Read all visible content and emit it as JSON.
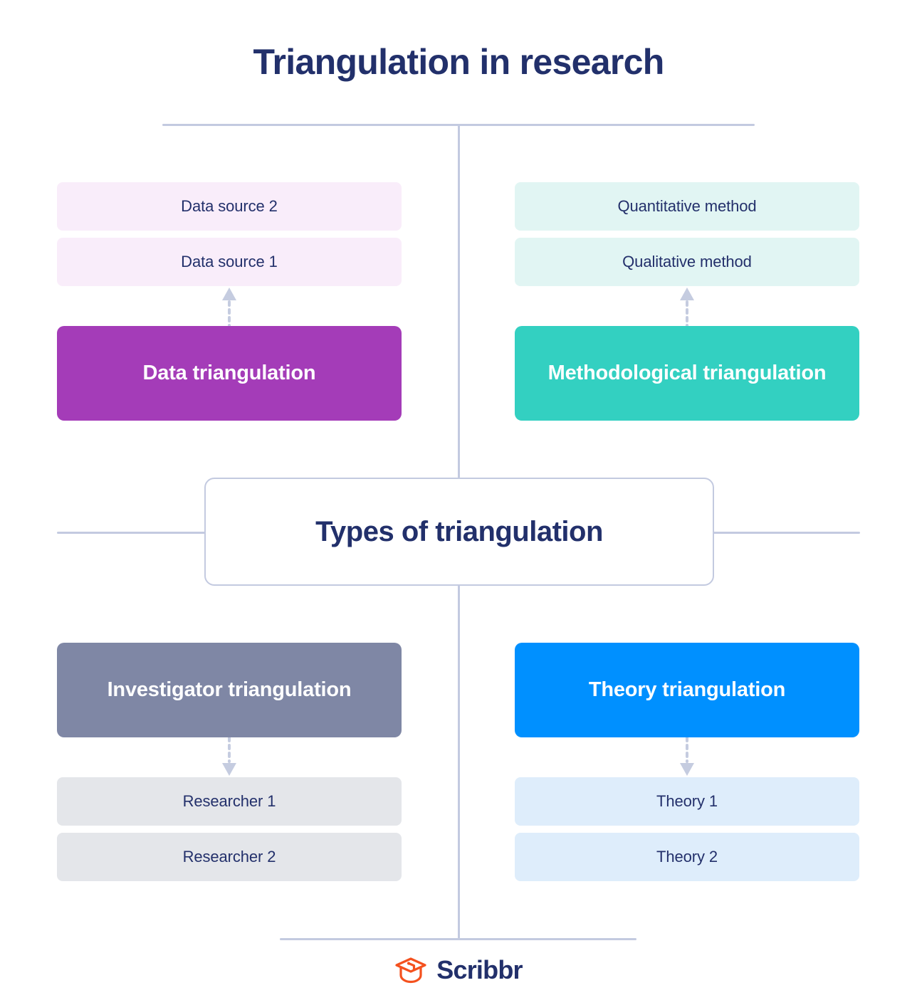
{
  "header": {
    "title": "Triangulation in research"
  },
  "center": {
    "label": "Types of triangulation"
  },
  "diagram_data": {
    "type": "diagram",
    "layout": "four-quadrant hub-and-spoke",
    "hub": "Types of triangulation",
    "branches": [
      {
        "id": "data",
        "label": "Data triangulation",
        "quadrant": "top-left",
        "accent_color": "#A43CB8",
        "sub_color": "#F9EDFA",
        "arrow_direction": "up",
        "items": [
          "Data source 2",
          "Data source 1"
        ]
      },
      {
        "id": "methodological",
        "label": "Methodological triangulation",
        "quadrant": "top-right",
        "accent_color": "#33D0C1",
        "sub_color": "#E1F5F3",
        "arrow_direction": "up",
        "items": [
          "Quantitative method",
          "Qualitative method"
        ]
      },
      {
        "id": "investigator",
        "label": "Investigator triangulation",
        "quadrant": "bottom-left",
        "accent_color": "#7F87A5",
        "sub_color": "#E4E6EA",
        "arrow_direction": "down",
        "items": [
          "Researcher 1",
          "Researcher 2"
        ]
      },
      {
        "id": "theory",
        "label": "Theory triangulation",
        "quadrant": "bottom-right",
        "accent_color": "#0090FF",
        "sub_color": "#DEEDFB",
        "arrow_direction": "down",
        "items": [
          "Theory 1",
          "Theory 2"
        ]
      }
    ]
  },
  "quadrants": {
    "data": {
      "main_label": "Data triangulation",
      "sub_1": "Data source 2",
      "sub_2": "Data source 1"
    },
    "methodological": {
      "main_label": "Methodological triangulation",
      "sub_1": "Quantitative method",
      "sub_2": "Qualitative method"
    },
    "investigator": {
      "main_label": "Investigator triangulation",
      "sub_1": "Researcher 1",
      "sub_2": "Researcher 2"
    },
    "theory": {
      "main_label": "Theory triangulation",
      "sub_1": "Theory 1",
      "sub_2": "Theory 2"
    }
  },
  "footer": {
    "brand": "Scribbr",
    "logo_icon": "graduation-cap-icon"
  },
  "colors": {
    "title_navy": "#22306B",
    "text_navy": "#23306B",
    "connector_line": "#C3CAE0",
    "arrow": "#C5CCE0",
    "purple": "#A43CB8",
    "purple_pale": "#F9EDFA",
    "teal": "#33D0C1",
    "teal_pale": "#E1F5F3",
    "slate": "#7F87A5",
    "slate_pale": "#E4E6EA",
    "blue": "#0090FF",
    "blue_pale": "#DEEDFB",
    "brand_orange": "#F4511E"
  }
}
